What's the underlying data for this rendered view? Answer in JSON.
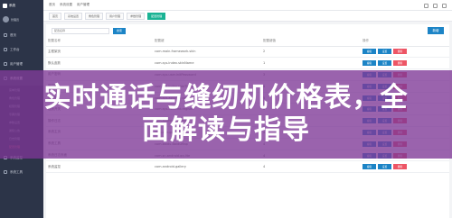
{
  "brand": {
    "name": "系统"
  },
  "user": {
    "name": "管理员"
  },
  "sidebar": {
    "items": [
      {
        "label": "首页"
      },
      {
        "label": "工作台"
      },
      {
        "label": "用户管理"
      },
      {
        "label": "系统设置"
      }
    ],
    "subitems": [
      "菜单管理",
      "角色管理",
      "权限管理",
      "字典管理",
      "参数设置",
      "通知公告",
      "日志管理",
      "配置管理"
    ],
    "bottom_items": [
      {
        "label": "系统监控"
      },
      {
        "label": "系统工具"
      }
    ]
  },
  "topbar": {
    "links": [
      "首页",
      "系统设置",
      "用户管理"
    ]
  },
  "tabs": [
    "首页",
    "系统设置",
    "角色管理",
    "用户管理",
    "参数管理",
    "配置管理"
  ],
  "toolbar": {
    "search_placeholder": "配置名称",
    "search_label": "搜索",
    "add_label": "新增"
  },
  "table": {
    "columns": [
      "配置名称",
      "配置键",
      "配置键值",
      "操作"
    ],
    "ops": [
      "编辑",
      "设置",
      "删除"
    ],
    "rows": [
      {
        "name": "主框架页",
        "key": "com.main.framework.skin",
        "value": "2"
      },
      {
        "name": "默认皮肤",
        "key": "com.sys.index.skinName",
        "value": "1"
      },
      {
        "name": "用户密码",
        "key": "com.sys.user.initPassword",
        "value": "3"
      },
      {
        "name": "侧边栏",
        "key": "com.sys.index.sideTheme",
        "value": "4"
      },
      {
        "name": "验证码",
        "key": "com.sys.account.captcha",
        "value": "5"
      },
      {
        "name": "注册开关",
        "key": "com.sys.account.register",
        "value": "6"
      },
      {
        "name": "操作日志",
        "key": "com.android.calendar",
        "value": "4"
      },
      {
        "name": "系统主页",
        "key": "com.crm.gifmaker",
        "value": "4"
      },
      {
        "name": "系统工具",
        "key": "com.baidu.BaiduMap",
        "value": "4"
      },
      {
        "name": "系统日志页面",
        "key": "com.sn.android.qq.lite",
        "value": "4"
      },
      {
        "name": "系统监控",
        "key": "com.android.gallery",
        "value": "4"
      }
    ]
  },
  "overlay": {
    "line1": "实时通话与缝纫机价格表，全",
    "line2": "面解读与指导"
  }
}
